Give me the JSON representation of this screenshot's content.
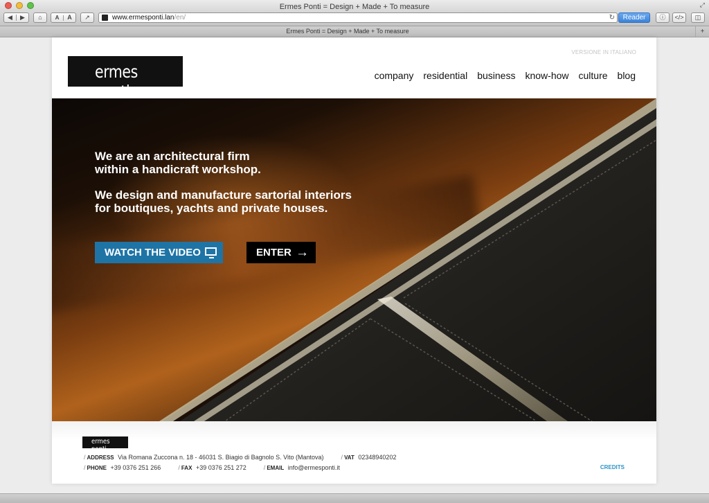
{
  "browser": {
    "window_title": "Ermes Ponti = Design + Made + To measure",
    "tab_title": "Ermes Ponti = Design + Made + To measure",
    "url_host": "www.ermesponti.lan",
    "url_path": "/en/",
    "reader_label": "Reader",
    "text_small": "A",
    "text_large": "A"
  },
  "header": {
    "logo_text": "ermes ponti.",
    "lang_link": "VERSIONE IN ITALIANO",
    "nav": [
      "company",
      "residential",
      "business",
      "know-how",
      "culture",
      "blog"
    ]
  },
  "hero": {
    "line1": "We are an architectural firm",
    "line2": "within a handicraft workshop.",
    "line3": "We design and manufacture sartorial interiors",
    "line4": "for boutiques, yachts and private houses.",
    "video_button": "WATCH THE VIDEO",
    "enter_button": "ENTER"
  },
  "footer": {
    "logo_text": "ermes ponti.",
    "address_label": "ADDRESS",
    "address": "Via Romana Zuccona n. 18 - 46031 S. Biagio di Bagnolo S. Vito (Mantova)",
    "vat_label": "VAT",
    "vat": "02348940202",
    "phone_label": "PHONE",
    "phone": "+39 0376 251 266",
    "fax_label": "FAX",
    "fax": "+39 0376 251 272",
    "email_label": "EMAIL",
    "email": "info@ermesponti.it",
    "credits": "CREDITS"
  },
  "colors": {
    "accent_blue": "#1f74a6",
    "credits_blue": "#2c93c5",
    "logo_bg": "#111111"
  }
}
